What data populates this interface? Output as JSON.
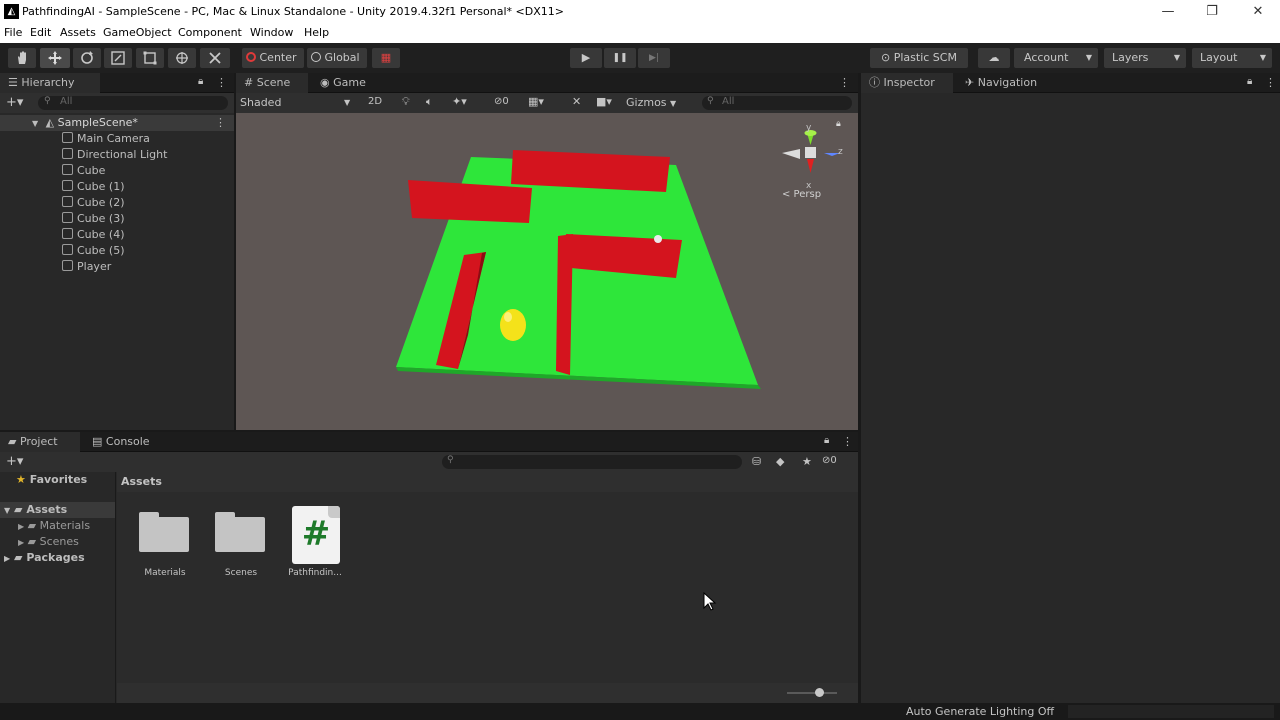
{
  "window": {
    "title": "PathfindingAI - SampleScene - PC, Mac & Linux Standalone - Unity 2019.4.32f1 Personal* <DX11>",
    "logo": "unity-logo",
    "controls": {
      "minimize": "—",
      "restore": "❐",
      "close": "✕"
    }
  },
  "menu": [
    "File",
    "Edit",
    "Assets",
    "GameObject",
    "Component",
    "Window",
    "Help"
  ],
  "toolbar": {
    "tools": [
      "hand-icon",
      "move-icon",
      "rotate-icon",
      "scale-icon",
      "rect-icon",
      "transform-icon",
      "custom-tool-icon"
    ],
    "pivot": "Center",
    "space": "Global",
    "play": "▶",
    "pause": "❚❚",
    "step": "▶|",
    "plastic": "Plastic SCM",
    "account": "Account",
    "layers": "Layers",
    "layout": "Layout"
  },
  "hierarchy": {
    "tab": "Hierarchy",
    "search_placeholder": "All",
    "scene": "SampleScene*",
    "items": [
      "Main Camera",
      "Directional Light",
      "Cube",
      "Cube (1)",
      "Cube (2)",
      "Cube (3)",
      "Cube (4)",
      "Cube (5)",
      "Player"
    ]
  },
  "scene_view": {
    "tabs": [
      "Scene",
      "Game"
    ],
    "shading": "Shaded",
    "mode2d": "2D",
    "hidden_count": "0",
    "gizmos": "Gizmos",
    "search_placeholder": "All",
    "persp_label": "< Persp",
    "axes": {
      "x": "x",
      "y": "y",
      "z": "z"
    },
    "colors": {
      "ground": "#2ee63a",
      "walls": "#d4141e",
      "player": "#f4e21a",
      "sky": "#5e5654"
    }
  },
  "inspector": {
    "tabs": [
      "Inspector",
      "Navigation"
    ]
  },
  "project": {
    "tabs": [
      "Project",
      "Console"
    ],
    "favorites": "Favorites",
    "tree": {
      "assets": "Assets",
      "children": [
        "Materials",
        "Scenes"
      ],
      "packages": "Packages"
    },
    "breadcrumb": "Assets",
    "assets": [
      {
        "name": "Materials",
        "type": "folder"
      },
      {
        "name": "Scenes",
        "type": "folder"
      },
      {
        "name": "Pathfindin...",
        "type": "script",
        "glyph": "#"
      }
    ],
    "hidden_count": "0"
  },
  "status": {
    "lighting": "Auto Generate Lighting Off"
  }
}
